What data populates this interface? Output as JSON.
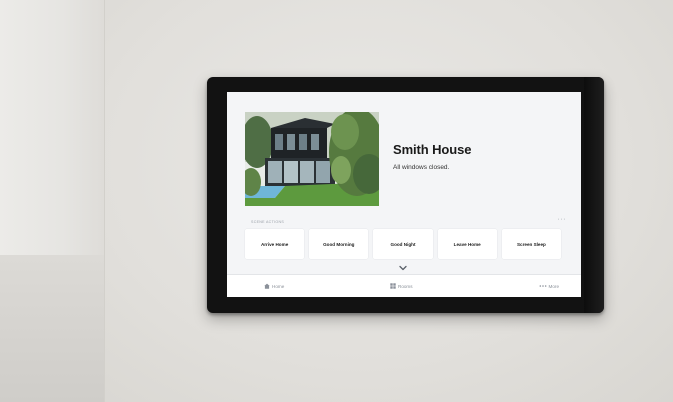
{
  "house": {
    "name": "Smith House",
    "status": "All windows closed."
  },
  "scenes": {
    "section_label": "Scene actions",
    "more_label": "···",
    "items": [
      {
        "label": "Arrive Home"
      },
      {
        "label": "Good Morning"
      },
      {
        "label": "Good Night"
      },
      {
        "label": "Leave Home"
      },
      {
        "label": "Screen Sleep"
      }
    ]
  },
  "nav": {
    "home": {
      "label": "Home",
      "icon": "house-icon"
    },
    "rooms": {
      "label": "Rooms",
      "icon": "grid-icon"
    },
    "more": {
      "label": "More",
      "icon": "ellipsis-icon"
    }
  },
  "colors": {
    "screen_bg": "#f4f5f7",
    "bezel": "#121212",
    "title_text": "#1a1a1a",
    "nav_text": "#8a9099"
  }
}
